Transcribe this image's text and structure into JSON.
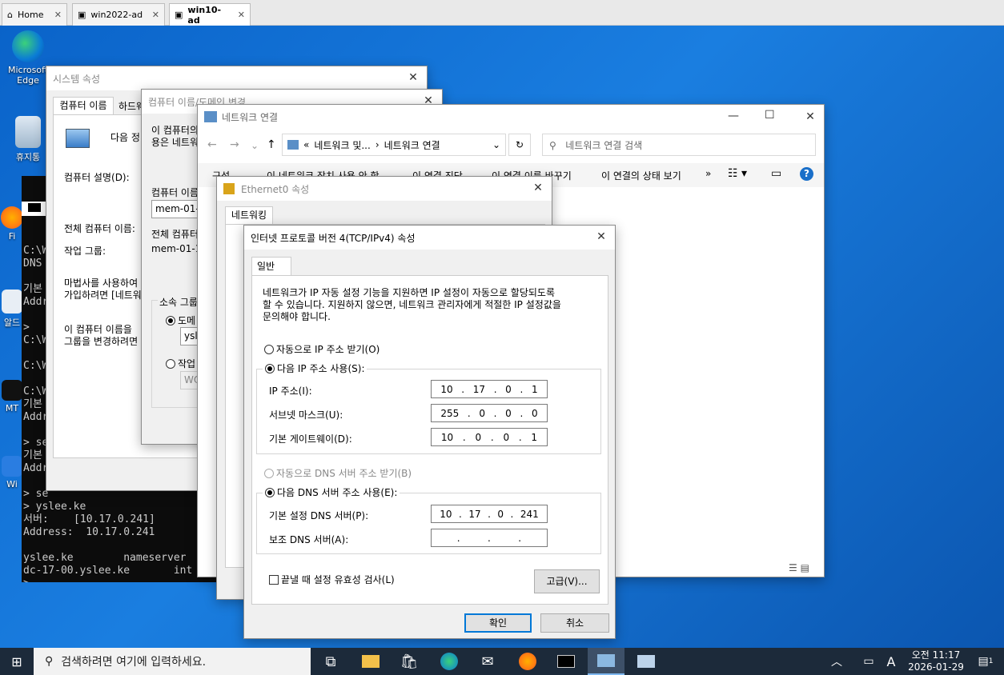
{
  "vmtabs": [
    {
      "label": "Home"
    },
    {
      "label": "win2022-ad"
    },
    {
      "label": "win10-ad"
    }
  ],
  "desktop_icons": [
    {
      "label": "Microsoft Edge"
    },
    {
      "label": "휴지통"
    },
    {
      "label": "Fi"
    },
    {
      "label": "알드"
    },
    {
      "label": "MT"
    },
    {
      "label": "Wi"
    }
  ],
  "cmd": {
    "lines": [
      "C:\\Wi",
      "DNS",
      "",
      "기본",
      "Addr",
      "",
      "> ",
      "C:\\Wi",
      "",
      "C:\\Wi",
      "",
      "C:\\Wi",
      "기본",
      "Addr",
      "",
      "> se",
      "기본",
      "Addr",
      "",
      "> se",
      "> yslee.ke",
      "서버:    [10.17.0.241]",
      "Address:  10.17.0.241",
      "",
      "yslee.ke        nameserver",
      "dc-17-00.yslee.ke       int",
      ">"
    ]
  },
  "sysprops": {
    "title": "시스템 속성",
    "tab1": "컴퓨터 이름",
    "tab2": "하드웨",
    "next": "다음 정",
    "desc_label": "컴퓨터 설명(D):",
    "full_label": "전체 컴퓨터 이름:",
    "wg_label": "작업 그룹:",
    "wizard1": "마법사를 사용하여",
    "wizard2": "가입하려면 [네트워",
    "rename1": "이 컴퓨터 이름을",
    "rename2": "그룹을 변경하려면"
  },
  "rename": {
    "title": "컴퓨터 이름/도메인 변경",
    "line1": "이 컴퓨터의",
    "line2": "용은 네트워",
    "name_label": "컴퓨터 이름",
    "name_value": "mem-01-",
    "full_label": "전체 컴퓨터",
    "full_value": "mem-01-1",
    "member": "소속 그룹",
    "domain": "도메",
    "domain_value": "ysle",
    "workgroup": "작업",
    "wg_value": "WO"
  },
  "netconn": {
    "title": "네트워크 연결",
    "path1": "네트워크 및...",
    "path2": "네트워크 연결",
    "search_placeholder": "네트워크 연결 검색",
    "cmd_org": "구성",
    "cmd_disable": "이 네트워크 장치 사용 안 함",
    "cmd_diag": "이 연결 진단",
    "cmd_rename": "이 연결 이름 바꾸기",
    "cmd_status": "이 연결의 상태 보기",
    "more": "»"
  },
  "eth": {
    "title": "Ethernet0 속성",
    "tab": "네트워킹"
  },
  "ipv4": {
    "title": "인터넷 프로토콜 버전 4(TCP/IPv4) 속성",
    "tab": "일반",
    "desc": [
      "네트워크가 IP 자동 설정 기능을 지원하면 IP 설정이 자동으로 할당되도록",
      "할 수 있습니다. 지원하지 않으면, 네트워크 관리자에게 적절한 IP 설정값을",
      "문의해야 합니다."
    ],
    "auto_ip": "자동으로 IP 주소 받기(O)",
    "manual_ip": "다음 IP 주소 사용(S):",
    "ip_label": "IP 주소(I):",
    "ip": [
      "10",
      "17",
      "0",
      "1"
    ],
    "mask_label": "서브넷 마스크(U):",
    "mask": [
      "255",
      "0",
      "0",
      "0"
    ],
    "gw_label": "기본 게이트웨이(D):",
    "gw": [
      "10",
      "0",
      "0",
      "1"
    ],
    "auto_dns": "자동으로 DNS 서버 주소 받기(B)",
    "manual_dns": "다음 DNS 서버 주소 사용(E):",
    "dns1_label": "기본 설정 DNS 서버(P):",
    "dns1": [
      "10",
      "17",
      "0",
      "241"
    ],
    "dns2_label": "보조 DNS 서버(A):",
    "dns2": [
      "",
      "",
      "",
      ""
    ],
    "validate": "끝낼 때 설정 유효성 검사(L)",
    "advanced": "고급(V)...",
    "ok": "확인",
    "cancel": "취소"
  },
  "taskbar": {
    "search_placeholder": "검색하려면 여기에 입력하세요.",
    "ime": "A",
    "time": "오전 11:17",
    "date": "2026-01-29",
    "notif": "1"
  }
}
